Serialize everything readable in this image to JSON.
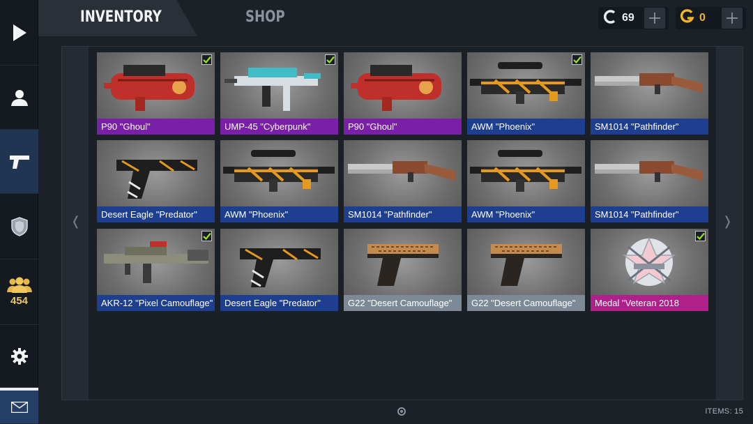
{
  "header": {
    "tabs": [
      {
        "label": "INVENTORY",
        "active": true
      },
      {
        "label": "SHOP",
        "active": false
      }
    ],
    "currencies": [
      {
        "icon": "credits-icon",
        "symbol": "C",
        "value": "69",
        "color": "#e8eef5"
      },
      {
        "icon": "gold-icon",
        "symbol": "G",
        "value": "0",
        "color": "#f0b429"
      }
    ]
  },
  "sidebar": {
    "items": [
      {
        "name": "play",
        "icon": "play-icon"
      },
      {
        "name": "profile",
        "icon": "user-icon"
      },
      {
        "name": "inventory",
        "icon": "pistol-icon",
        "active": true
      },
      {
        "name": "clan",
        "icon": "shield-icon"
      },
      {
        "name": "friends",
        "icon": "friends-icon",
        "count": "454"
      },
      {
        "name": "settings",
        "icon": "gear-icon"
      },
      {
        "name": "mail",
        "icon": "mail-icon"
      }
    ]
  },
  "inventory": {
    "items": [
      {
        "name": "P90 \"Ghoul\"",
        "rarity_color": "#7a1fa8",
        "equipped": true,
        "art": "p90"
      },
      {
        "name": "UMP-45 \"Cyberpunk\"",
        "rarity_color": "#7a1fa8",
        "equipped": true,
        "art": "ump"
      },
      {
        "name": "P90 \"Ghoul\"",
        "rarity_color": "#7a1fa8",
        "equipped": false,
        "art": "p90"
      },
      {
        "name": "AWM \"Phoenix\"",
        "rarity_color": "#1e3f8f",
        "equipped": true,
        "art": "awm"
      },
      {
        "name": "SM1014 \"Pathfinder\"",
        "rarity_color": "#1e3f8f",
        "equipped": false,
        "art": "shotgun"
      },
      {
        "name": "Desert Eagle \"Predator\"",
        "rarity_color": "#1e3f8f",
        "equipped": false,
        "art": "deagle"
      },
      {
        "name": "AWM \"Phoenix\"",
        "rarity_color": "#1e3f8f",
        "equipped": false,
        "art": "awm"
      },
      {
        "name": "SM1014 \"Pathfinder\"",
        "rarity_color": "#1e3f8f",
        "equipped": false,
        "art": "shotgun"
      },
      {
        "name": "AWM \"Phoenix\"",
        "rarity_color": "#1e3f8f",
        "equipped": false,
        "art": "awm"
      },
      {
        "name": "SM1014 \"Pathfinder\"",
        "rarity_color": "#1e3f8f",
        "equipped": false,
        "art": "shotgun"
      },
      {
        "name": "AKR-12 \"Pixel Camouflage\"",
        "rarity_color": "#1e3f8f",
        "equipped": true,
        "art": "akr"
      },
      {
        "name": "Desert Eagle \"Predator\"",
        "rarity_color": "#1e3f8f",
        "equipped": false,
        "art": "deagle"
      },
      {
        "name": "G22 \"Desert Camouflage\"",
        "rarity_color": "#7d8a96",
        "equipped": false,
        "art": "glock"
      },
      {
        "name": "G22 \"Desert Camouflage\"",
        "rarity_color": "#7d8a96",
        "equipped": false,
        "art": "glock"
      },
      {
        "name": "Medal \"Veteran 2018",
        "rarity_color": "#b0208a",
        "equipped": true,
        "art": "medal"
      }
    ],
    "items_count_label": "ITEMS: 15"
  }
}
